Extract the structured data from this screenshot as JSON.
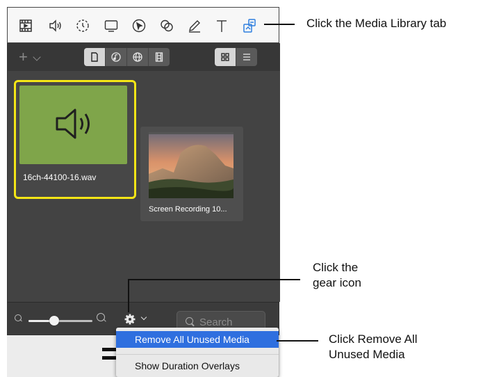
{
  "toolbar": {
    "icons": [
      "media-bin-icon",
      "audio-icon",
      "transitions-icon",
      "callouts-icon",
      "cursor-icon",
      "annotations-icon",
      "pencil-icon",
      "text-icon",
      "media-library-icon"
    ],
    "active_icon": "media-library-icon",
    "active_color": "#2f7fdf"
  },
  "panel": {
    "view_toggles": [
      "document-icon",
      "music-icon",
      "globe-icon",
      "film-icon"
    ],
    "layout_toggles": [
      "grid-view-icon",
      "list-view-icon"
    ],
    "items": [
      {
        "label": "16ch-44100-16.wav",
        "type": "audio",
        "selected": true
      },
      {
        "label": "Screen Recording 10...",
        "type": "video",
        "selected": false
      }
    ],
    "selection_color": "#f5e616"
  },
  "bottom": {
    "zoom_level": 0.4,
    "search_placeholder": "Search"
  },
  "menu": {
    "items": [
      {
        "label": "Remove All Unused Media",
        "highlighted": true
      },
      {
        "label": "Show Duration Overlays",
        "highlighted": false
      }
    ],
    "highlight_color": "#2f6fdf"
  },
  "callouts": {
    "media_library": "Click the Media Library tab",
    "gear_line1": "Click the",
    "gear_line2": "gear icon",
    "remove_line1": "Click Remove All",
    "remove_line2": "Unused Media"
  }
}
